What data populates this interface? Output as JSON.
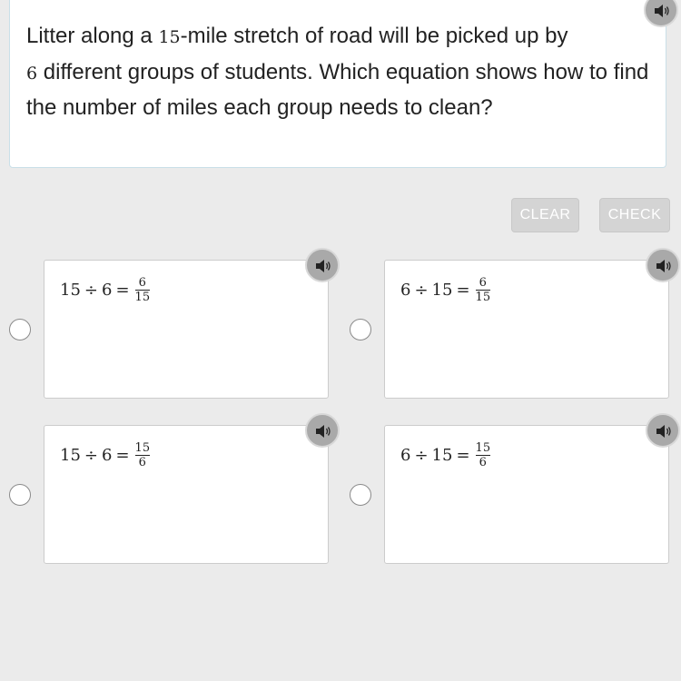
{
  "question": {
    "text_before_1": "Litter along a ",
    "number_1": "15",
    "text_middle": "-mile stretch of road will be picked up by",
    "number_2": "6",
    "text_after": " different groups of students. Which equation shows how to find the number of miles each group needs to clean?",
    "audio_icon": "speaker-icon"
  },
  "actions": {
    "clear_label": "CLEAR",
    "check_label": "CHECK"
  },
  "options": [
    {
      "left": "15",
      "op": "÷",
      "right": "6",
      "eq": "=",
      "num": "6",
      "den": "15"
    },
    {
      "left": "6",
      "op": "÷",
      "right": "15",
      "eq": "=",
      "num": "6",
      "den": "15"
    },
    {
      "left": "15",
      "op": "÷",
      "right": "6",
      "eq": "=",
      "num": "15",
      "den": "6"
    },
    {
      "left": "6",
      "op": "÷",
      "right": "15",
      "eq": "=",
      "num": "15",
      "den": "6"
    }
  ],
  "colors": {
    "background": "#ebebeb",
    "card": "#ffffff",
    "button_disabled": "#d4d4d4",
    "audio_button": "#a9a9a9"
  }
}
